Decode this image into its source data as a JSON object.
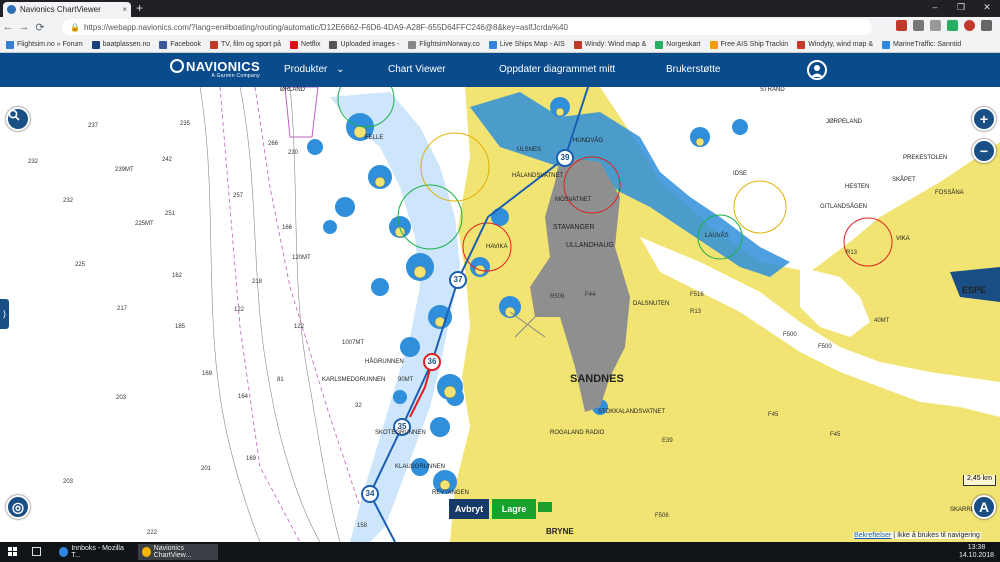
{
  "browser": {
    "tab_title": "Navionics ChartViewer",
    "tab_close": "×",
    "new_tab": "+",
    "url": "https://webapp.navionics.com/?lang=en#boating/routing/automatic/D12E6662-F6D6-4DA9-A28F-655D64FFC246@8&key=aslfJcrda%40",
    "nav": {
      "back": "←",
      "forward": "→",
      "reload": "⟳"
    },
    "window_controls": {
      "minimize": "–",
      "maximize": "❐",
      "close": "✕"
    },
    "bookmarks": [
      {
        "label": "Flightsim.no » Forum",
        "color": "#3a7bd5"
      },
      {
        "label": "baatplassen.no",
        "color": "#1c3e7a"
      },
      {
        "label": "Facebook",
        "color": "#3b5998"
      },
      {
        "label": "TV, film og sport på",
        "color": "#c0392b"
      },
      {
        "label": "Netflix",
        "color": "#e50914"
      },
      {
        "label": "Uploaded images -",
        "color": "#555"
      },
      {
        "label": "FlightsimNorway.co",
        "color": "#888"
      },
      {
        "label": "Live Ships Map - AIS",
        "color": "#2e86de"
      },
      {
        "label": "Windy: Wind map &",
        "color": "#c0392b"
      },
      {
        "label": "Norgeskart",
        "color": "#27ae60"
      },
      {
        "label": "Free AIS Ship Trackin",
        "color": "#f39c12"
      },
      {
        "label": "Windyty, wind map &",
        "color": "#c0392b"
      },
      {
        "label": "MarineTraffic: Sanntid",
        "color": "#2e86de"
      }
    ]
  },
  "header": {
    "brand": "NAVIONICS",
    "brand_sub": "A Garmin Company",
    "nav": [
      {
        "label": "Produkter",
        "caret": "⌄"
      },
      {
        "label": "Chart Viewer"
      },
      {
        "label": "Oppdater diagrammet mitt"
      },
      {
        "label": "Brukerstøtte"
      }
    ]
  },
  "map": {
    "controls": {
      "search_icon": "🔍",
      "zoom_in": "+",
      "zoom_out": "−",
      "side_toggle": "⟩",
      "compass": "◎",
      "route_icon": "A"
    },
    "buttons": {
      "cancel": "Avbryt",
      "save": "Lagre"
    },
    "scale": "2,45 km",
    "footer_link": "Bekreftelser",
    "footer_text": " | Ikke å brukes til navigering",
    "route_waypoints": [
      "39",
      "37",
      "36",
      "35",
      "34"
    ],
    "place_names": [
      "SANDNES",
      "STAVANGER",
      "ULLANDHAUG",
      "HÅGRUNNEN",
      "KARLSMEDGRUNNEN",
      "SKOTEGRUNNEN",
      "KLAUSGRUNNEN",
      "REVTANGEN",
      "BRYNE",
      "STOKKALANDSVATNET",
      "ROGALAND RADIO",
      "HÅLANDSVATNET",
      "MOSVATNET",
      "DALSNUTEN",
      "GITLANDSÅGEN",
      "LAUVÅS",
      "PREKESTOLEN",
      "HESTEN",
      "SKÅPET",
      "FOSSÅNA",
      "ESPE",
      "JØRPELAND",
      "STRAND",
      "VIKA",
      "ULSNES",
      "HUNDVÅG",
      "HAVIKA",
      "IDSE",
      "FELLE",
      "SKARRBEVE",
      "ØRLAND"
    ],
    "depth_labels": [
      "237",
      "235",
      "232",
      "242",
      "239MT",
      "232",
      "225MT",
      "251",
      "266",
      "230",
      "257",
      "225",
      "162",
      "217",
      "185",
      "169",
      "203",
      "201",
      "203",
      "222",
      "164",
      "166",
      "120MT",
      "218",
      "122",
      "122",
      "1007MT",
      "81",
      "90MT",
      "32",
      "169",
      "158",
      "F516",
      "R13",
      "F500",
      "F500",
      "F45",
      "F45",
      "E39",
      "F506",
      "F44",
      "R509",
      "R13",
      "40MT"
    ]
  },
  "taskbar": {
    "apps": [
      {
        "label": "Innboks - Mozilla T...",
        "color": "#2e86de"
      },
      {
        "label": "Navionics ChartView...",
        "color": "#f4b400"
      }
    ],
    "time": "13:38",
    "date": "14.10.2018"
  }
}
